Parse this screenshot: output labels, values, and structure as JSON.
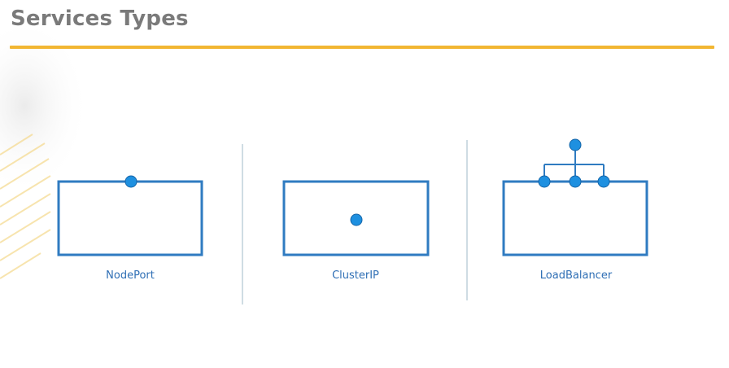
{
  "slide": {
    "title": "Services Types"
  },
  "colors": {
    "accent_rule": "#f2b632",
    "box_stroke": "#2f7bc1",
    "node_fill": "#1e90e0",
    "label_text": "#2f6fb5",
    "title_text": "#7a7a7a"
  },
  "services": [
    {
      "label": "NodePort"
    },
    {
      "label": "ClusterIP"
    },
    {
      "label": "LoadBalancer"
    }
  ]
}
